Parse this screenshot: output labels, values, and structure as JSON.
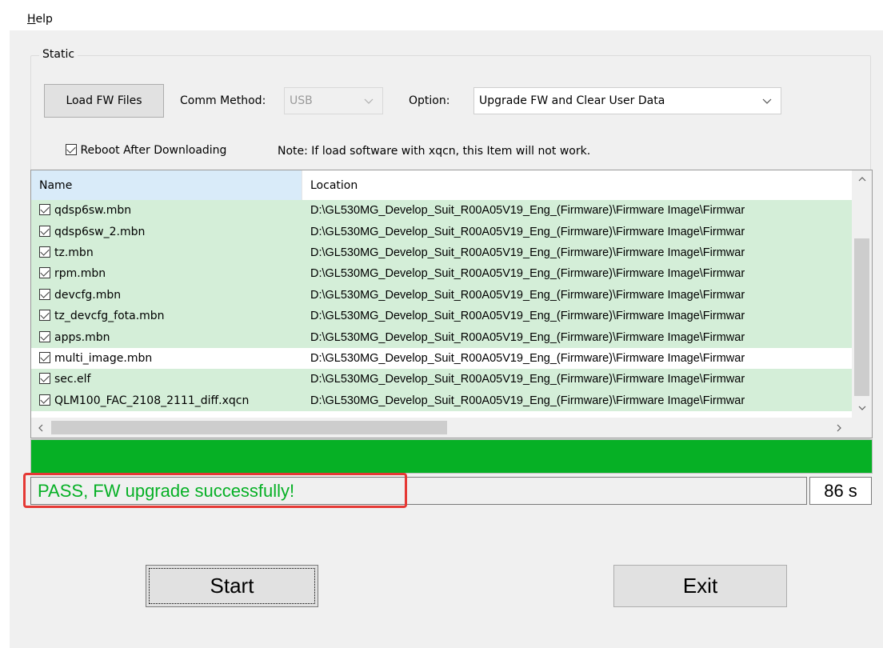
{
  "menubar": {
    "help_prefix": "H",
    "help_rest": "elp"
  },
  "group": {
    "title": "Static"
  },
  "toolbar": {
    "load_fw_label": "Load FW Files",
    "comm_method_label": "Comm Method:",
    "comm_method_value": "USB",
    "option_label": "Option:",
    "option_value": "Upgrade FW and Clear User Data"
  },
  "reboot": {
    "label": "Reboot After Downloading",
    "checked": true
  },
  "note": "Note: If load software with xqcn, this Item will not work.",
  "table": {
    "columns": [
      "Name",
      "Location"
    ],
    "rows": [
      {
        "name": "qdsp6sw.mbn",
        "location": "D:\\GL530MG_Develop_Suit_R00A05V19_Eng_(Firmware)\\Firmware Image\\Firmwar",
        "checked": true
      },
      {
        "name": "qdsp6sw_2.mbn",
        "location": "D:\\GL530MG_Develop_Suit_R00A05V19_Eng_(Firmware)\\Firmware Image\\Firmwar",
        "checked": true
      },
      {
        "name": "tz.mbn",
        "location": "D:\\GL530MG_Develop_Suit_R00A05V19_Eng_(Firmware)\\Firmware Image\\Firmwar",
        "checked": true
      },
      {
        "name": "rpm.mbn",
        "location": "D:\\GL530MG_Develop_Suit_R00A05V19_Eng_(Firmware)\\Firmware Image\\Firmwar",
        "checked": true
      },
      {
        "name": "devcfg.mbn",
        "location": "D:\\GL530MG_Develop_Suit_R00A05V19_Eng_(Firmware)\\Firmware Image\\Firmwar",
        "checked": true
      },
      {
        "name": "tz_devcfg_fota.mbn",
        "location": "D:\\GL530MG_Develop_Suit_R00A05V19_Eng_(Firmware)\\Firmware Image\\Firmwar",
        "checked": true
      },
      {
        "name": "apps.mbn",
        "location": "D:\\GL530MG_Develop_Suit_R00A05V19_Eng_(Firmware)\\Firmware Image\\Firmwar",
        "checked": true
      },
      {
        "name": "multi_image.mbn",
        "location": "D:\\GL530MG_Develop_Suit_R00A05V19_Eng_(Firmware)\\Firmware Image\\Firmwar",
        "checked": true
      },
      {
        "name": "sec.elf",
        "location": "D:\\GL530MG_Develop_Suit_R00A05V19_Eng_(Firmware)\\Firmware Image\\Firmwar",
        "checked": true
      },
      {
        "name": "QLM100_FAC_2108_2111_diff.xqcn",
        "location": "D:\\GL530MG_Develop_Suit_R00A05V19_Eng_(Firmware)\\Firmware Image\\Firmwar",
        "checked": true
      }
    ]
  },
  "progress": {
    "percent": 100,
    "color": "#06b025"
  },
  "status": {
    "text": "PASS, FW upgrade successfully!",
    "color": "#06b025",
    "elapsed": "86 s"
  },
  "buttons": {
    "start": "Start",
    "exit": "Exit"
  },
  "colors": {
    "row_highlight": "#d4eed8",
    "header_highlight": "#d9ebf9",
    "annotation_box": "#e53935"
  },
  "icons": {
    "checkbox": "checkbox-checked-icon",
    "dropdown": "chevron-down-icon"
  }
}
